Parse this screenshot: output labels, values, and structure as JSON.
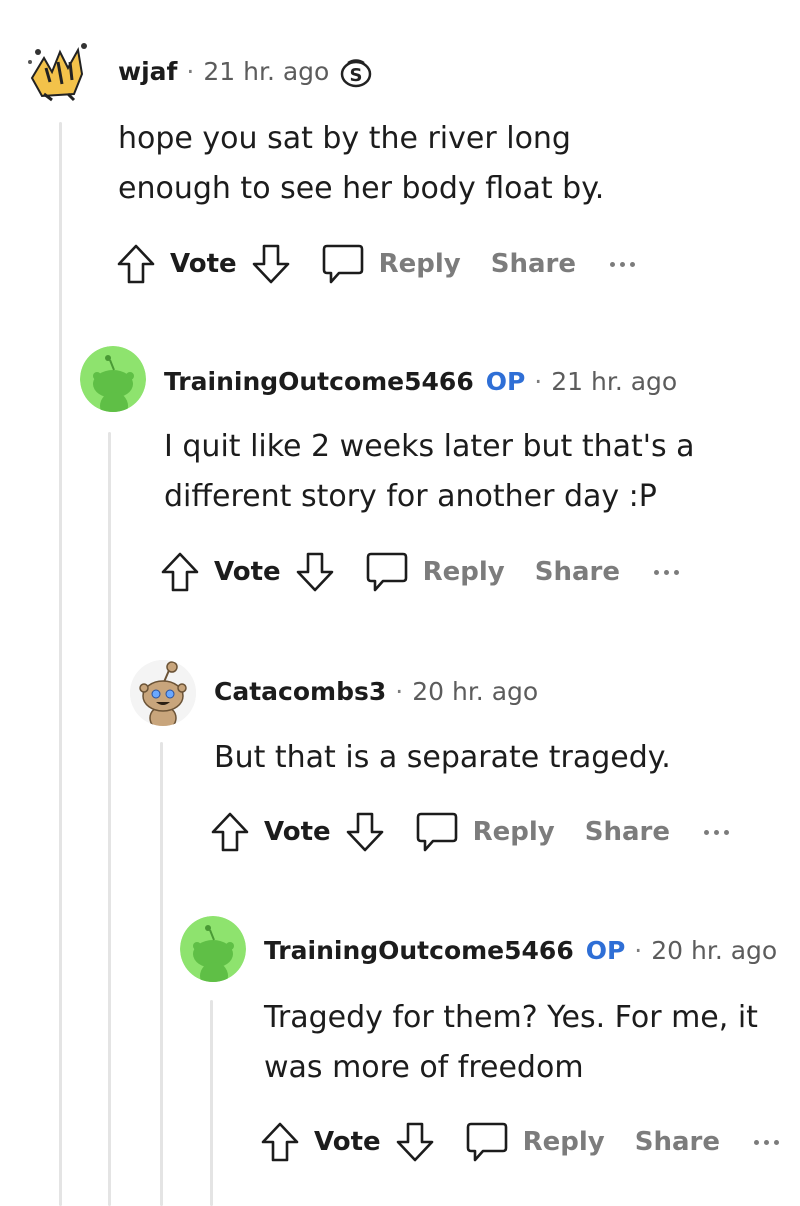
{
  "colors": {
    "op_badge": "#2f6fd6",
    "thread_line": "#e4e4e4",
    "muted": "#7c7c7c",
    "avatar_green": "#8ee36e"
  },
  "comments": [
    {
      "username": "wjaf",
      "op_label": "",
      "time": "21 hr. ago",
      "flair_icon": "snoo-s-badge-icon",
      "text": "hope you sat by the river long enough to see her body float by.",
      "actions": {
        "vote": "Vote",
        "reply": "Reply",
        "share": "Share"
      }
    },
    {
      "username": "TrainingOutcome5466",
      "op_label": "OP",
      "time": "21 hr. ago",
      "text": "I quit like 2 weeks later but that's a different story for another day :P",
      "actions": {
        "vote": "Vote",
        "reply": "Reply",
        "share": "Share"
      }
    },
    {
      "username": "Catacombs3",
      "op_label": "",
      "time": "20 hr. ago",
      "text": "But that is a separate tragedy.",
      "actions": {
        "vote": "Vote",
        "reply": "Reply",
        "share": "Share"
      }
    },
    {
      "username": "TrainingOutcome5466",
      "op_label": "OP",
      "time": "20 hr. ago",
      "text": "Tragedy for them? Yes. For me, it was more of freedom",
      "actions": {
        "vote": "Vote",
        "reply": "Reply",
        "share": "Share"
      }
    }
  ]
}
